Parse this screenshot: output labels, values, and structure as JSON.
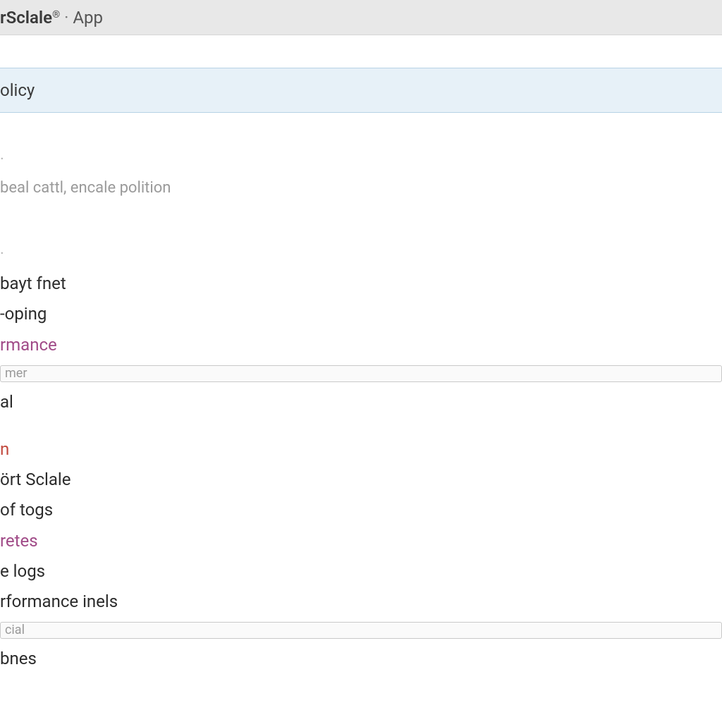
{
  "titlebar": {
    "product": "rSclale",
    "reg": "®",
    "separator": "·",
    "sub": "App"
  },
  "highlight": {
    "label": "olicy"
  },
  "desc": {
    "line": "beal cattl, encale polition"
  },
  "group1": {
    "dash": "·",
    "items": {
      "0": "bayt fnet",
      "1": "-oping",
      "2": "rmance",
      "tag": "mer",
      "3": "al"
    }
  },
  "group2": {
    "items": {
      "0": "n",
      "1": "ört Sclale",
      "2": "of togs",
      "3": "retes",
      "4": "e logs",
      "5": "rformance inels",
      "tag": "cial",
      "6": "bnes"
    }
  }
}
